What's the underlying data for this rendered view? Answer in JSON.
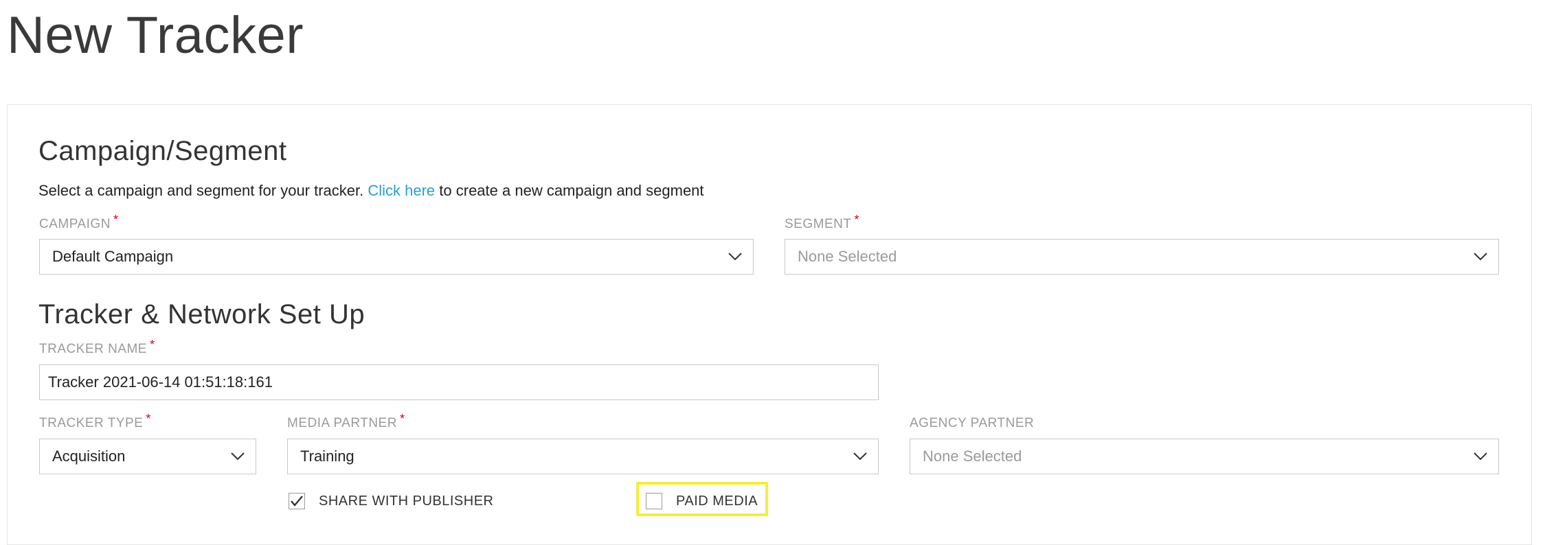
{
  "page": {
    "title": "New Tracker"
  },
  "campaign_section": {
    "title": "Campaign/Segment",
    "desc_before": "Select a campaign and segment for your tracker. ",
    "desc_link": "Click here",
    "desc_after": " to create a new campaign and segment",
    "campaign_label": "CAMPAIGN",
    "campaign_value": "Default Campaign",
    "segment_label": "SEGMENT",
    "segment_value": "None Selected"
  },
  "tracker_section": {
    "title": "Tracker & Network Set Up",
    "tracker_name_label": "TRACKER NAME",
    "tracker_name_value": "Tracker 2021-06-14 01:51:18:161",
    "tracker_type_label": "TRACKER TYPE",
    "tracker_type_value": "Acquisition",
    "media_partner_label": "MEDIA PARTNER",
    "media_partner_value": "Training",
    "agency_partner_label": "AGENCY PARTNER",
    "agency_partner_value": "None Selected",
    "share_with_publisher_label": "SHARE WITH PUBLISHER",
    "share_with_publisher_checked": true,
    "paid_media_label": "PAID MEDIA",
    "paid_media_checked": false
  },
  "required_marker": "*",
  "colors": {
    "link": "#2a9fd6",
    "required": "#d0021b",
    "highlight": "#f4ee3a"
  },
  "icons": {
    "dropdown": "chevron-down-icon",
    "check": "checkmark-icon"
  }
}
